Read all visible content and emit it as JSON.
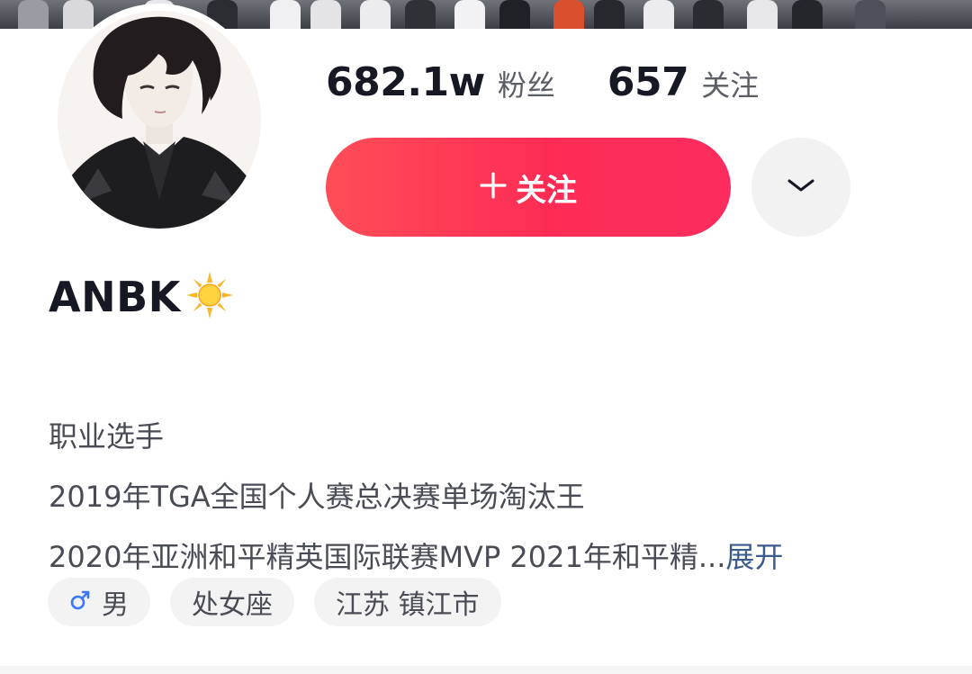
{
  "profile": {
    "nickname": "ANBK",
    "nickname_emoji": "sun-emoji-icon"
  },
  "stats": {
    "followers_count": "682.1w",
    "followers_label": "粉丝",
    "following_count": "657",
    "following_label": "关注"
  },
  "actions": {
    "follow_label": "关注",
    "follow_icon": "plus-icon",
    "more_icon": "chevron-down-icon",
    "follow_color": "#fe2c55"
  },
  "bio": {
    "line1": "职业选手",
    "line2": "2019年TGA全国个人赛总决赛单场淘汰王",
    "line3": "2020年亚洲和平精英国际联赛MVP 2021年和平精",
    "ellipsis": "...",
    "expand_label": "展开"
  },
  "tags": {
    "gender_icon": "male-icon",
    "gender": "男",
    "zodiac": "处女座",
    "location": "江苏 镇江市"
  }
}
